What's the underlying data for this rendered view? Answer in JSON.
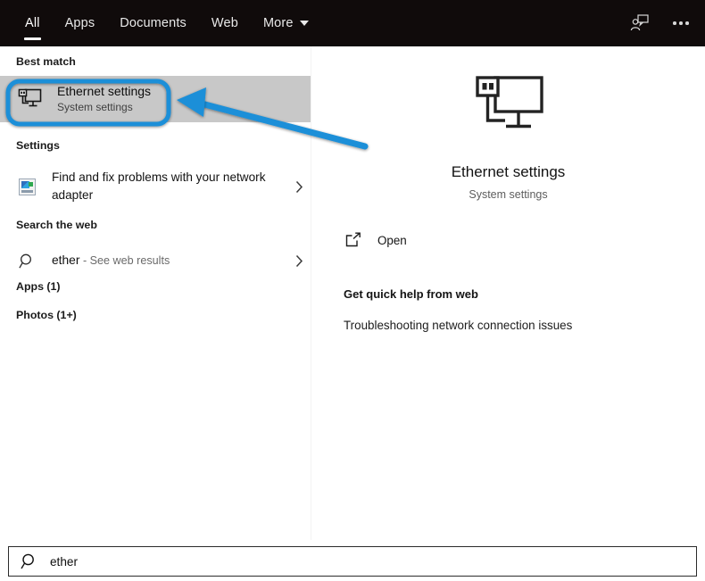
{
  "header": {
    "tabs": [
      {
        "label": "All",
        "active": true,
        "has_caret": false
      },
      {
        "label": "Apps",
        "active": false,
        "has_caret": false
      },
      {
        "label": "Documents",
        "active": false,
        "has_caret": false
      },
      {
        "label": "Web",
        "active": false,
        "has_caret": false
      },
      {
        "label": "More",
        "active": false,
        "has_caret": true
      }
    ],
    "feedback_icon": "feedback-person-icon",
    "overflow_icon": "ellipsis-icon"
  },
  "left_pane": {
    "best_match_label": "Best match",
    "best_match": {
      "title": "Ethernet settings",
      "subtitle": "System settings",
      "icon": "ethernet-monitor-icon",
      "selected": true
    },
    "settings_label": "Settings",
    "settings_items": [
      {
        "label": "Find and fix problems with your network adapter",
        "icon": "network-troubleshooter-icon",
        "chevron": "chevron-right-icon"
      }
    ],
    "search_web_label": "Search the web",
    "web_items": [
      {
        "query": "ether",
        "tail": " - See web results",
        "icon": "search-icon",
        "chevron": "chevron-right-icon"
      }
    ],
    "apps_label": "Apps (1)",
    "photos_label": "Photos (1+)"
  },
  "right_pane": {
    "icon": "ethernet-monitor-icon",
    "title": "Ethernet settings",
    "subtitle": "System settings",
    "actions": [
      {
        "label": "Open",
        "icon": "open-external-icon"
      }
    ],
    "help_title": "Get quick help from web",
    "help_links": [
      "Troubleshooting network connection issues"
    ]
  },
  "search_bar": {
    "icon": "search-icon",
    "value": "ether",
    "placeholder": "Type here to search"
  },
  "annotations": {
    "highlight_box": {
      "name": "ethernet-settings-highlight-box",
      "color": "#1a8fd8"
    },
    "arrow": {
      "name": "pointer-arrow",
      "color": "#1a8fd8"
    }
  },
  "colors": {
    "header_bg": "#100b0b",
    "selection_bg": "#c8c8c8",
    "annotation_blue": "#1a8fd8",
    "page_bg": "#ffffff"
  }
}
